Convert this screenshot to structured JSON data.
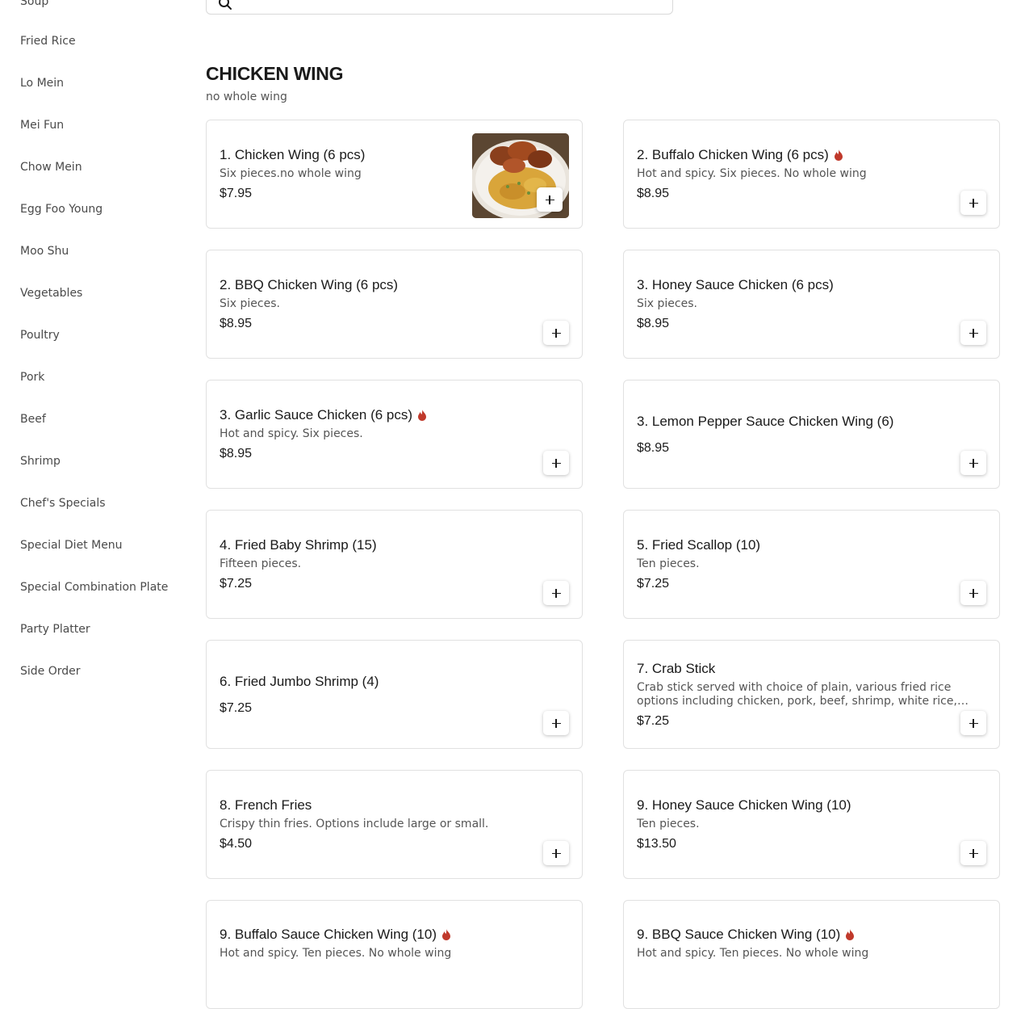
{
  "sidebar": {
    "items": [
      {
        "label": "Soup"
      },
      {
        "label": "Fried Rice"
      },
      {
        "label": "Lo Mein"
      },
      {
        "label": "Mei Fun"
      },
      {
        "label": "Chow Mein"
      },
      {
        "label": "Egg Foo Young"
      },
      {
        "label": "Moo Shu"
      },
      {
        "label": "Vegetables"
      },
      {
        "label": "Poultry"
      },
      {
        "label": "Pork"
      },
      {
        "label": "Beef"
      },
      {
        "label": "Shrimp"
      },
      {
        "label": "Chef's Specials"
      },
      {
        "label": "Special Diet Menu"
      },
      {
        "label": "Special Combination Plate"
      },
      {
        "label": "Party Platter"
      },
      {
        "label": "Side Order"
      }
    ]
  },
  "search": {
    "icon": "search-icon",
    "placeholder": ""
  },
  "section": {
    "title": "CHICKEN WING",
    "subtitle": "no whole wing"
  },
  "items": [
    {
      "name": "1. Chicken Wing (6 pcs)",
      "description": "Six pieces.no whole wing",
      "price": "$7.95",
      "spicy": false,
      "has_image": true,
      "image": "chicken-wings-with-fried-rice-photo"
    },
    {
      "name": "2. Buffalo Chicken Wing (6 pcs)",
      "description": "Hot and spicy. Six pieces. No whole wing",
      "price": "$8.95",
      "spicy": true
    },
    {
      "name": "2. BBQ Chicken Wing (6 pcs)",
      "description": "Six pieces.",
      "price": "$8.95",
      "spicy": false
    },
    {
      "name": "3. Honey Sauce Chicken (6 pcs)",
      "description": "Six pieces.",
      "price": "$8.95",
      "spicy": false
    },
    {
      "name": "3. Garlic Sauce Chicken (6 pcs)",
      "description": "Hot and spicy. Six pieces.",
      "price": "$8.95",
      "spicy": true
    },
    {
      "name": "3. Lemon Pepper Sauce Chicken Wing (6)",
      "description": "",
      "price": "$8.95",
      "spicy": false
    },
    {
      "name": "4. Fried Baby Shrimp (15)",
      "description": "Fifteen pieces.",
      "price": "$7.25",
      "spicy": false
    },
    {
      "name": "5. Fried Scallop (10)",
      "description": "Ten pieces.",
      "price": "$7.25",
      "spicy": false
    },
    {
      "name": "6. Fried Jumbo Shrimp (4)",
      "description": "",
      "price": "$7.25",
      "spicy": false
    },
    {
      "name": "7. Crab Stick",
      "description": "Crab stick served with choice of plain, various fried rice options including chicken, pork, beef, shrimp, white rice, or…",
      "price": "$7.25",
      "spicy": false
    },
    {
      "name": "8. French Fries",
      "description": "Crispy thin fries. Options include large or small.",
      "price": "$4.50",
      "spicy": false
    },
    {
      "name": "9. Honey Sauce Chicken Wing (10)",
      "description": "Ten pieces.",
      "price": "$13.50",
      "spicy": false
    },
    {
      "name": "9. Buffalo Sauce Chicken Wing (10)",
      "description": "Hot and spicy. Ten pieces. No whole wing",
      "price": "",
      "spicy": true
    },
    {
      "name": "9. BBQ Sauce Chicken Wing (10)",
      "description": "Hot and spicy. Ten pieces. No whole wing",
      "price": "",
      "spicy": true
    }
  ],
  "colors": {
    "spicy": "#c0392b",
    "border": "#e1e1e1",
    "text": "#1a1a1a",
    "muted": "#555555"
  }
}
